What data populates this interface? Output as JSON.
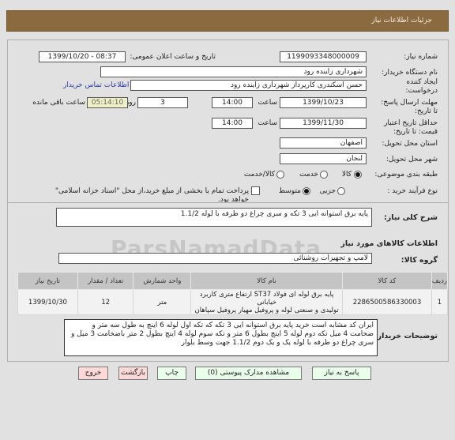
{
  "header": {
    "title": "جزئیات اطلاعات نیاز"
  },
  "form": {
    "need_number": {
      "label": "شماره نیاز:",
      "value": "1199093348000009"
    },
    "announce_datetime": {
      "label": "تاریخ و ساعت اعلان عمومی:",
      "value": "1399/10/20 - 08:37"
    },
    "buyer_org": {
      "label": "نام دستگاه خریدار:",
      "value": "شهرداری زاینده رود"
    },
    "requester": {
      "label_line1": "ایجاد کننده",
      "label_line2": "درخواست:",
      "value": "حسن  اسکندری  کارپرداز شهرداری زاینده رود"
    },
    "buyer_contact_link": "اطلاعات تماس خریدار",
    "reply_deadline": {
      "label_line1": "مهلت ارسال پاسخ:",
      "label_line2": "تا تاریخ:",
      "date": "1399/10/23",
      "time_label": "ساعت",
      "time": "14:00",
      "days": "3",
      "days_label": "روز و",
      "remaining": "05:14:10",
      "remaining_label": "ساعت باقی مانده"
    },
    "price_validity": {
      "label_line1": "حداقل تاریخ اعتبار",
      "label_line2": "قیمت: تا تاریخ:",
      "date": "1399/11/30",
      "time_label": "ساعت",
      "time": "14:00"
    },
    "province": {
      "label": "استان محل تحویل:",
      "value": "اصفهان"
    },
    "city": {
      "label": "شهر محل تحویل:",
      "value": "لنجان"
    },
    "category": {
      "label": "طبقه بندی موضوعی:",
      "options": [
        {
          "label": "کالا",
          "selected": true
        },
        {
          "label": "خدمت",
          "selected": false
        },
        {
          "label": "کالا/خدمت",
          "selected": false
        }
      ]
    },
    "purchase_process": {
      "label": "نوع فرآیند خرید :",
      "options": [
        {
          "label": "جزیی",
          "selected": false
        },
        {
          "label": "متوسط",
          "selected": true
        }
      ],
      "treasury_checkbox": {
        "checked": false,
        "label": "پرداخت تمام یا بخشی از مبلغ خرید،از محل \"اسناد خزانه اسلامی\" خواهد بود."
      }
    }
  },
  "details": {
    "summary_label": "شرح کلی نیاز:",
    "summary_value": "پایه برق استوانه ایی 3 تکه و سری چراغ دو طرفه با لوله  1.1/2",
    "goods_info_title": "اطلاعات کالاهای مورد نیاز",
    "goods_group_label": "گروه کالا:",
    "goods_group_value": "لامپ و تجهیزات روشنائی",
    "table": {
      "headers": [
        "ردیف",
        "کد کالا",
        "نام کالا",
        "واحد شمارش",
        "تعداد / مقدار",
        "تاریخ نیاز"
      ],
      "rows": [
        {
          "row": "1",
          "code": "2286500586330003",
          "name_line1": "پایه برق لوله ای فولاد ST37 ارتفاع متری کاربرد خیابانی",
          "name_line2": "تولیدی و صنعتی لوله و پروفیل مهیار پروفیل سپاهان",
          "unit": "متر",
          "quantity": "12",
          "need_date": "1399/10/30"
        }
      ]
    },
    "buyer_notes_label": "توضیحات خریدار:",
    "buyer_notes_lines": [
      "ایران کد مشابه است خرید پایه برق استوانه ایی 3 تکه که تکه اول لوله 6 اینچ به طول سه متر  و",
      "ضخامت 4 میل تکه دوم لوله 5 اینچ بطول 6 متر و تکه سوم لوله 4 اینچ بطول 2 متر باضخامت 3 میل و",
      "سری چراغ دو طرفه با لوله یک و  یک دوم     1.1/2  جهت وسط بلوار"
    ]
  },
  "watermark": "ParsNamadData",
  "buttons": {
    "reply": "پاسخ به نیاز",
    "attachments": "مشاهده مدارک پیوستی (0)",
    "print": "چاپ",
    "back": "بازگشت",
    "exit": "خروج"
  },
  "colors": {
    "header_bg": "#8c6a3f",
    "green_button": "#eaffea",
    "pink_button": "#ffd8d8",
    "link": "#2a3da8",
    "remaining_bg": "#f0f0c8"
  }
}
